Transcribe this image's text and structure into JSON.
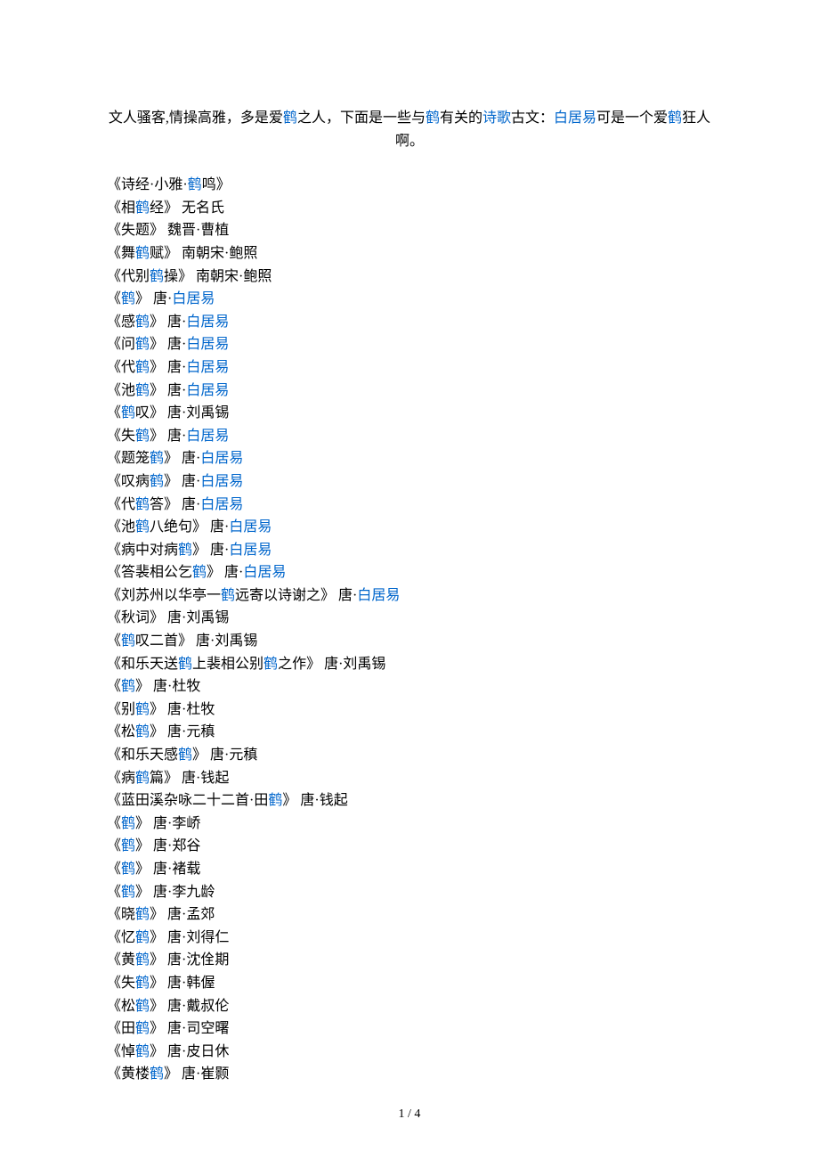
{
  "intro": {
    "segments": [
      {
        "text": "文人骚客,情操高雅，多是爱",
        "link": false
      },
      {
        "text": "鹤",
        "link": true
      },
      {
        "text": "之人，下面是一些与",
        "link": false
      },
      {
        "text": "鹤",
        "link": true
      },
      {
        "text": "有关的",
        "link": false
      },
      {
        "text": "诗歌",
        "link": true
      },
      {
        "text": "古文：",
        "link": false
      },
      {
        "text": "白居易",
        "link": true
      },
      {
        "text": "可是一个爱",
        "link": false
      },
      {
        "text": "鹤",
        "link": true
      },
      {
        "text": "狂人啊。",
        "link": false
      }
    ]
  },
  "items": [
    {
      "segments": [
        {
          "text": "《诗经·小雅·",
          "link": false
        },
        {
          "text": "鹤",
          "link": true
        },
        {
          "text": "鸣》",
          "link": false
        }
      ]
    },
    {
      "segments": [
        {
          "text": "《相",
          "link": false
        },
        {
          "text": "鹤",
          "link": true
        },
        {
          "text": "经》 无名氏",
          "link": false
        }
      ]
    },
    {
      "segments": [
        {
          "text": "《失题》 魏晋·曹植",
          "link": false
        }
      ]
    },
    {
      "segments": [
        {
          "text": "《舞",
          "link": false
        },
        {
          "text": "鹤",
          "link": true
        },
        {
          "text": "赋》 南朝宋·鲍照",
          "link": false
        }
      ]
    },
    {
      "segments": [
        {
          "text": "《代别",
          "link": false
        },
        {
          "text": "鹤",
          "link": true
        },
        {
          "text": "操》 南朝宋·鲍照",
          "link": false
        }
      ]
    },
    {
      "segments": [
        {
          "text": "《",
          "link": false
        },
        {
          "text": "鹤",
          "link": true
        },
        {
          "text": "》 唐·",
          "link": false
        },
        {
          "text": "白居易",
          "link": true
        }
      ]
    },
    {
      "segments": [
        {
          "text": "《感",
          "link": false
        },
        {
          "text": "鹤",
          "link": true
        },
        {
          "text": "》 唐·",
          "link": false
        },
        {
          "text": "白居易",
          "link": true
        }
      ]
    },
    {
      "segments": [
        {
          "text": "《问",
          "link": false
        },
        {
          "text": "鹤",
          "link": true
        },
        {
          "text": "》 唐·",
          "link": false
        },
        {
          "text": "白居易",
          "link": true
        }
      ]
    },
    {
      "segments": [
        {
          "text": "《代",
          "link": false
        },
        {
          "text": "鹤",
          "link": true
        },
        {
          "text": "》 唐·",
          "link": false
        },
        {
          "text": "白居易",
          "link": true
        }
      ]
    },
    {
      "segments": [
        {
          "text": "《池",
          "link": false
        },
        {
          "text": "鹤",
          "link": true
        },
        {
          "text": "》 唐·",
          "link": false
        },
        {
          "text": "白居易",
          "link": true
        }
      ]
    },
    {
      "segments": [
        {
          "text": "《",
          "link": false
        },
        {
          "text": "鹤",
          "link": true
        },
        {
          "text": "叹》 唐·刘禹锡",
          "link": false
        }
      ]
    },
    {
      "segments": [
        {
          "text": "《失",
          "link": false
        },
        {
          "text": "鹤",
          "link": true
        },
        {
          "text": "》 唐·",
          "link": false
        },
        {
          "text": "白居易",
          "link": true
        }
      ]
    },
    {
      "segments": [
        {
          "text": "《题笼",
          "link": false
        },
        {
          "text": "鹤",
          "link": true
        },
        {
          "text": "》 唐·",
          "link": false
        },
        {
          "text": "白居易",
          "link": true
        }
      ]
    },
    {
      "segments": [
        {
          "text": "《叹病",
          "link": false
        },
        {
          "text": "鹤",
          "link": true
        },
        {
          "text": "》 唐·",
          "link": false
        },
        {
          "text": "白居易",
          "link": true
        }
      ]
    },
    {
      "segments": [
        {
          "text": "《代",
          "link": false
        },
        {
          "text": "鹤",
          "link": true
        },
        {
          "text": "答》 唐·",
          "link": false
        },
        {
          "text": "白居易",
          "link": true
        }
      ]
    },
    {
      "segments": [
        {
          "text": "《池",
          "link": false
        },
        {
          "text": "鹤",
          "link": true
        },
        {
          "text": "八绝句》 唐·",
          "link": false
        },
        {
          "text": "白居易",
          "link": true
        }
      ]
    },
    {
      "segments": [
        {
          "text": "《病中对病",
          "link": false
        },
        {
          "text": "鹤",
          "link": true
        },
        {
          "text": "》 唐·",
          "link": false
        },
        {
          "text": "白居易",
          "link": true
        }
      ]
    },
    {
      "segments": [
        {
          "text": "《答裴相公乞",
          "link": false
        },
        {
          "text": "鹤",
          "link": true
        },
        {
          "text": "》 唐·",
          "link": false
        },
        {
          "text": "白居易",
          "link": true
        }
      ]
    },
    {
      "segments": [
        {
          "text": "《刘苏州以华亭一",
          "link": false
        },
        {
          "text": "鹤",
          "link": true
        },
        {
          "text": "远寄以诗谢之》 唐·",
          "link": false
        },
        {
          "text": "白居易",
          "link": true
        }
      ]
    },
    {
      "segments": [
        {
          "text": "《秋词》 唐·刘禹锡",
          "link": false
        }
      ]
    },
    {
      "segments": [
        {
          "text": "《",
          "link": false
        },
        {
          "text": "鹤",
          "link": true
        },
        {
          "text": "叹二首》 唐·刘禹锡",
          "link": false
        }
      ]
    },
    {
      "segments": [
        {
          "text": "《和乐天送",
          "link": false
        },
        {
          "text": "鹤",
          "link": true
        },
        {
          "text": "上裴相公别",
          "link": false
        },
        {
          "text": "鹤",
          "link": true
        },
        {
          "text": "之作》 唐·刘禹锡",
          "link": false
        }
      ]
    },
    {
      "segments": [
        {
          "text": "《",
          "link": false
        },
        {
          "text": "鹤",
          "link": true
        },
        {
          "text": "》 唐·杜牧",
          "link": false
        }
      ]
    },
    {
      "segments": [
        {
          "text": "《别",
          "link": false
        },
        {
          "text": "鹤",
          "link": true
        },
        {
          "text": "》 唐·杜牧",
          "link": false
        }
      ]
    },
    {
      "segments": [
        {
          "text": "《松",
          "link": false
        },
        {
          "text": "鹤",
          "link": true
        },
        {
          "text": "》 唐·元稹",
          "link": false
        }
      ]
    },
    {
      "segments": [
        {
          "text": "《和乐天感",
          "link": false
        },
        {
          "text": "鹤",
          "link": true
        },
        {
          "text": "》 唐·元稹",
          "link": false
        }
      ]
    },
    {
      "segments": [
        {
          "text": "《病",
          "link": false
        },
        {
          "text": "鹤",
          "link": true
        },
        {
          "text": "篇》 唐·钱起",
          "link": false
        }
      ]
    },
    {
      "segments": [
        {
          "text": "《蓝田溪杂咏二十二首·田",
          "link": false
        },
        {
          "text": "鹤",
          "link": true
        },
        {
          "text": "》 唐·钱起",
          "link": false
        }
      ]
    },
    {
      "segments": [
        {
          "text": "《",
          "link": false
        },
        {
          "text": "鹤",
          "link": true
        },
        {
          "text": "》 唐·李峤",
          "link": false
        }
      ]
    },
    {
      "segments": [
        {
          "text": "《",
          "link": false
        },
        {
          "text": "鹤",
          "link": true
        },
        {
          "text": "》 唐·郑谷",
          "link": false
        }
      ]
    },
    {
      "segments": [
        {
          "text": "《",
          "link": false
        },
        {
          "text": "鹤",
          "link": true
        },
        {
          "text": "》 唐·褚载",
          "link": false
        }
      ]
    },
    {
      "segments": [
        {
          "text": "《",
          "link": false
        },
        {
          "text": "鹤",
          "link": true
        },
        {
          "text": "》 唐·李九龄",
          "link": false
        }
      ]
    },
    {
      "segments": [
        {
          "text": "《晓",
          "link": false
        },
        {
          "text": "鹤",
          "link": true
        },
        {
          "text": "》 唐·孟郊",
          "link": false
        }
      ]
    },
    {
      "segments": [
        {
          "text": "《忆",
          "link": false
        },
        {
          "text": "鹤",
          "link": true
        },
        {
          "text": "》 唐·刘得仁",
          "link": false
        }
      ]
    },
    {
      "segments": [
        {
          "text": "《黄",
          "link": false
        },
        {
          "text": "鹤",
          "link": true
        },
        {
          "text": "》 唐·沈佺期",
          "link": false
        }
      ]
    },
    {
      "segments": [
        {
          "text": "《失",
          "link": false
        },
        {
          "text": "鹤",
          "link": true
        },
        {
          "text": "》 唐·韩偓",
          "link": false
        }
      ]
    },
    {
      "segments": [
        {
          "text": "《松",
          "link": false
        },
        {
          "text": "鹤",
          "link": true
        },
        {
          "text": "》 唐·戴叔伦",
          "link": false
        }
      ]
    },
    {
      "segments": [
        {
          "text": "《田",
          "link": false
        },
        {
          "text": "鹤",
          "link": true
        },
        {
          "text": "》 唐·司空曙",
          "link": false
        }
      ]
    },
    {
      "segments": [
        {
          "text": "《悼",
          "link": false
        },
        {
          "text": "鹤",
          "link": true
        },
        {
          "text": "》 唐·皮日休",
          "link": false
        }
      ]
    },
    {
      "segments": [
        {
          "text": "《黄楼",
          "link": false
        },
        {
          "text": "鹤",
          "link": true
        },
        {
          "text": "》 唐·崔颢",
          "link": false
        }
      ]
    }
  ],
  "pageNumber": "1 / 4"
}
